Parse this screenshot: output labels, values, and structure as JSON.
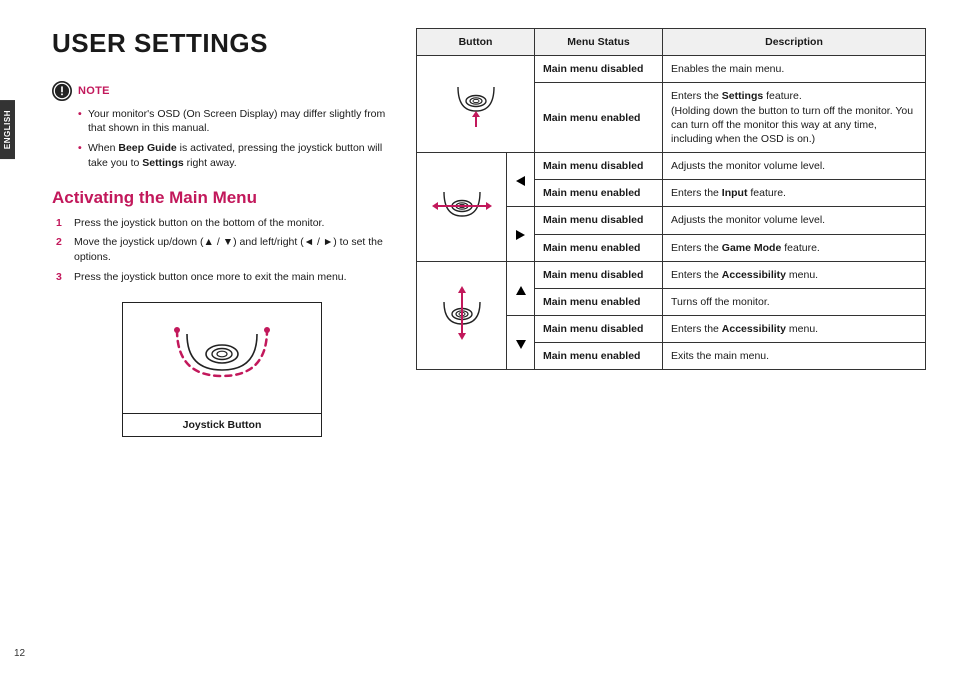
{
  "side_tab": "ENGLISH",
  "page_number": "12",
  "title": "USER SETTINGS",
  "note_label": "NOTE",
  "notes": [
    {
      "pre": "Your monitor's OSD (On Screen Display) may differ slightly from that shown in this manual."
    },
    {
      "pre": "When ",
      "bold1": "Beep Guide",
      "mid": " is activated, pressing the joystick button will take you to ",
      "bold2": "Settings",
      "post": " right away."
    }
  ],
  "subheading": "Activating the Main Menu",
  "steps": [
    "Press the joystick button on the bottom of the monitor.",
    "Move the joystick up/down (▲ / ▼) and left/right (◄ / ►) to set the options.",
    "Press the joystick button once more to exit the main menu."
  ],
  "joystick_caption": "Joystick Button",
  "table": {
    "headers": {
      "button": "Button",
      "menu_status": "Menu Status",
      "description": "Description"
    },
    "rows": [
      {
        "status": "Main menu disabled",
        "desc_plain": "Enables the main menu."
      },
      {
        "status": "Main menu enabled",
        "desc_parts": {
          "a": "Enters the ",
          "b": "Settings",
          "c": " feature.",
          "d": "(Holding down the button to turn off the monitor. You can turn off the monitor this way at any time, including when the OSD is on.)"
        }
      },
      {
        "status": "Main menu disabled",
        "desc_plain": "Adjusts the monitor volume level."
      },
      {
        "status": "Main menu enabled",
        "desc_parts": {
          "a": "Enters the ",
          "b": "Input",
          "c": " feature."
        }
      },
      {
        "status": "Main menu disabled",
        "desc_plain": "Adjusts the monitor volume level."
      },
      {
        "status": "Main menu enabled",
        "desc_parts": {
          "a": "Enters the ",
          "b": "Game Mode",
          "c": " feature."
        }
      },
      {
        "status": "Main menu disabled",
        "desc_parts": {
          "a": "Enters the ",
          "b": "Accessibility",
          "c": " menu."
        }
      },
      {
        "status": "Main menu enabled",
        "desc_plain": "Turns off the monitor."
      },
      {
        "status": "Main menu disabled",
        "desc_parts": {
          "a": "Enters the ",
          "b": "Accessibility",
          "c": " menu."
        }
      },
      {
        "status": "Main menu enabled",
        "desc_plain": "Exits the main menu."
      }
    ]
  }
}
